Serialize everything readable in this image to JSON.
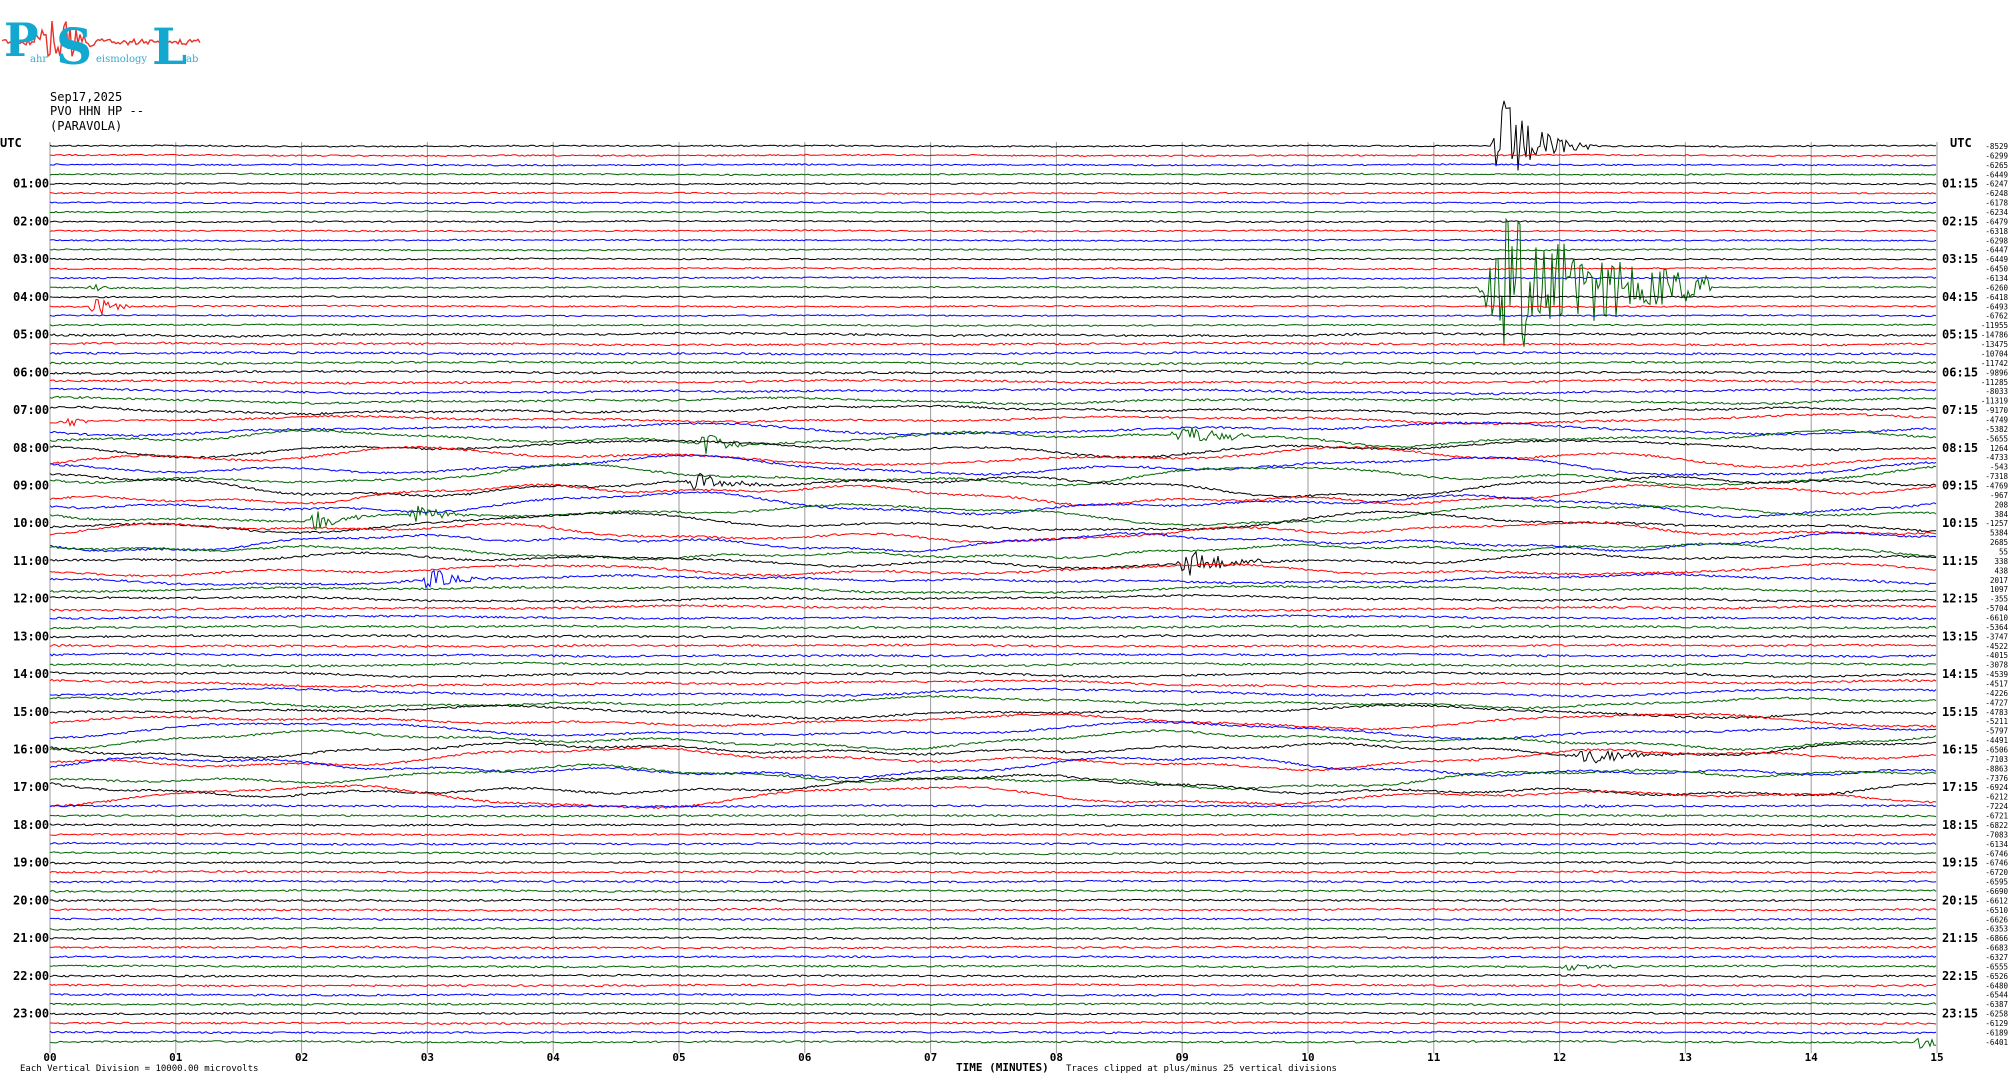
{
  "logo": {
    "letters": [
      "P",
      "S",
      "L"
    ],
    "tagline": [
      "ahr",
      "eismology",
      "ab"
    ],
    "colors": {
      "letters": "#12a8cf",
      "trace": "#e8322d",
      "tagline": "#3aa8d0"
    }
  },
  "header": {
    "date": "Sep17,2025",
    "station": "PVO HHN HP --",
    "site": "(PARAVOLA)"
  },
  "footer": {
    "scale_note": "Each Vertical Division = 10000.00 microvolts",
    "axis_title": "TIME (MINUTES)",
    "clip_note": "Traces clipped at plus/minus 25 vertical divisions"
  },
  "chart_data": {
    "type": "line",
    "subtype": "helicorder",
    "x_range": [
      0,
      15
    ],
    "x_ticks": [
      "00",
      "01",
      "02",
      "03",
      "04",
      "05",
      "06",
      "07",
      "08",
      "09",
      "10",
      "11",
      "12",
      "13",
      "14",
      "15"
    ],
    "xlabel": "TIME (MINUTES)",
    "left_axis_title": "UTC",
    "right_axis_title": "UTC",
    "left_hour_labels": [
      "01:00",
      "02:00",
      "03:00",
      "04:00",
      "05:00",
      "06:00",
      "07:00",
      "08:00",
      "09:00",
      "10:00",
      "11:00",
      "12:00",
      "13:00",
      "14:00",
      "15:00",
      "16:00",
      "17:00",
      "18:00",
      "19:00",
      "20:00",
      "21:00",
      "22:00",
      "23:00"
    ],
    "right_hour_labels": [
      "01:15",
      "02:15",
      "03:15",
      "04:15",
      "05:15",
      "06:15",
      "07:15",
      "08:15",
      "09:15",
      "10:15",
      "11:15",
      "12:15",
      "13:15",
      "14:15",
      "15:15",
      "16:15",
      "17:15",
      "18:15",
      "19:15",
      "20:15",
      "21:15",
      "22:15",
      "23:15"
    ],
    "trace_count": 96,
    "trace_color_cycle": [
      "#000000",
      "#ff0000",
      "#0000ff",
      "#006400"
    ],
    "grid": "vertical minute lines",
    "trace_offsets": [
      "-8529",
      "-6299",
      "-6265",
      "-6449",
      "-6247",
      "-6248",
      "-6178",
      "-6234",
      "-6479",
      "-6318",
      "-6298",
      "-6447",
      "-6449",
      "-6450",
      "-6134",
      "-6260",
      "-6418",
      "-6493",
      "-6762",
      "-11955",
      "-14786",
      "-13475",
      "-10704",
      "-11742",
      "-9896",
      "-11285",
      "-8033",
      "-11319",
      "-9170",
      "-4749",
      "-5382",
      "-5655",
      "1264",
      "-4733",
      "-543",
      "-7318",
      "-4769",
      "-967",
      "208",
      "384",
      "-1257",
      "5384",
      "2685",
      "55",
      "338",
      "438",
      "2017",
      "1097",
      "-355",
      "-5704",
      "-6610",
      "-5364",
      "-3747",
      "-4522",
      "-4015",
      "-3078",
      "-4539",
      "-4517",
      "-4226",
      "-4727",
      "-4783",
      "-5211",
      "-5797",
      "-4491",
      "-6506",
      "-7103",
      "-8863",
      "-7376",
      "-6924",
      "-6212",
      "-7224",
      "-6721",
      "-6822",
      "-7083",
      "-6134",
      "-6746",
      "-6746",
      "-6720",
      "-6595",
      "-6690",
      "-6612",
      "-6510",
      "-6626",
      "-6353",
      "-6866",
      "-6683",
      "-6327",
      "-6555",
      "-6526",
      "-6480",
      "-6544",
      "-6387",
      "-6258",
      "-6129",
      "-6189",
      "-6401"
    ],
    "events": [
      {
        "trace": 0,
        "start_min": 11.45,
        "end_min": 12.3,
        "amp": 8,
        "decay": 3.5
      },
      {
        "trace": 15,
        "start_min": 11.35,
        "end_min": 13.2,
        "amp": 10,
        "decay": 2.0
      },
      {
        "trace": 17,
        "start_min": 0.3,
        "end_min": 0.75,
        "amp": 1.6,
        "decay": 3.0
      },
      {
        "trace": 15,
        "start_min": 0.3,
        "end_min": 0.55,
        "amp": 1.0,
        "decay": 3.0
      },
      {
        "trace": 29,
        "start_min": 0.1,
        "end_min": 0.45,
        "amp": 0.8,
        "decay": 3.0
      },
      {
        "trace": 31,
        "start_min": 5.15,
        "end_min": 5.6,
        "amp": 2.2,
        "decay": 3.0
      },
      {
        "trace": 31,
        "start_min": 8.9,
        "end_min": 9.6,
        "amp": 1.5,
        "decay": 2.0
      },
      {
        "trace": 36,
        "start_min": 5.05,
        "end_min": 5.65,
        "amp": 1.3,
        "decay": 2.5
      },
      {
        "trace": 39,
        "start_min": 2.05,
        "end_min": 2.5,
        "amp": 1.8,
        "decay": 2.5
      },
      {
        "trace": 39,
        "start_min": 2.85,
        "end_min": 3.3,
        "amp": 1.4,
        "decay": 2.5
      },
      {
        "trace": 44,
        "start_min": 8.95,
        "end_min": 9.7,
        "amp": 2.2,
        "decay": 2.5
      },
      {
        "trace": 46,
        "start_min": 2.95,
        "end_min": 3.5,
        "amp": 1.6,
        "decay": 2.5
      },
      {
        "trace": 64,
        "start_min": 12.1,
        "end_min": 12.9,
        "amp": 1.2,
        "decay": 2.0
      },
      {
        "trace": 70,
        "start_min": 12.2,
        "end_min": 12.5,
        "amp": 0.8,
        "decay": 3.0
      },
      {
        "trace": 87,
        "start_min": 12.0,
        "end_min": 12.5,
        "amp": 0.6,
        "decay": 2.0
      },
      {
        "trace": 95,
        "start_min": 14.8,
        "end_min": 15.0,
        "amp": 1.0,
        "decay": 1.0
      }
    ]
  }
}
